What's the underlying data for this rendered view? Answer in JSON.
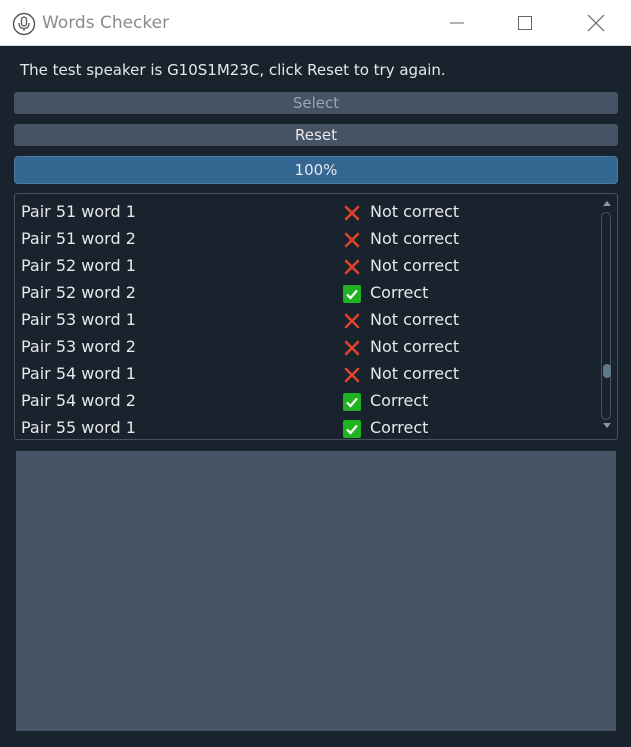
{
  "window": {
    "title": "Words Checker",
    "icon": "microphone-icon"
  },
  "info": {
    "text": "The test speaker is G10S1M23C, click Reset to try again."
  },
  "buttons": {
    "select_label": "Select",
    "reset_label": "Reset"
  },
  "progress": {
    "label": "100%",
    "value": 100
  },
  "results": [
    {
      "word": "Pair 51 word 1",
      "status": "Not correct",
      "correct": false
    },
    {
      "word": "Pair 51 word 2",
      "status": "Not correct",
      "correct": false
    },
    {
      "word": "Pair 52 word 1",
      "status": "Not correct",
      "correct": false
    },
    {
      "word": "Pair 52 word 2",
      "status": "Correct",
      "correct": true
    },
    {
      "word": "Pair 53 word 1",
      "status": "Not correct",
      "correct": false
    },
    {
      "word": "Pair 53 word 2",
      "status": "Not correct",
      "correct": false
    },
    {
      "word": "Pair 54 word 1",
      "status": "Not correct",
      "correct": false
    },
    {
      "word": "Pair 54 word 2",
      "status": "Correct",
      "correct": true
    },
    {
      "word": "Pair 55 word 1",
      "status": "Correct",
      "correct": true
    }
  ],
  "colors": {
    "background": "#19232d",
    "button": "#455364",
    "progress_fill": "#346792",
    "correct": "#1fb322",
    "incorrect": "#e0442a"
  }
}
